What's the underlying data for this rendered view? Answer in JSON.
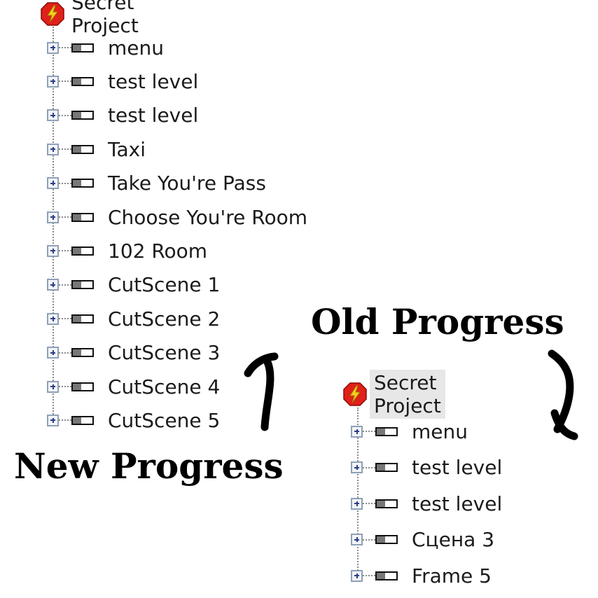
{
  "new_tree": {
    "root_label": "Secret Project",
    "items": [
      {
        "label": "menu"
      },
      {
        "label": "test level"
      },
      {
        "label": "test level"
      },
      {
        "label": "Taxi"
      },
      {
        "label": "Take You're Pass"
      },
      {
        "label": "Choose You're Room"
      },
      {
        "label": "102 Room"
      },
      {
        "label": "CutScene 1"
      },
      {
        "label": "CutScene 2"
      },
      {
        "label": "CutScene 3"
      },
      {
        "label": "CutScene 4"
      },
      {
        "label": "CutScene 5"
      }
    ]
  },
  "old_tree": {
    "root_label": "Secret Project",
    "items": [
      {
        "label": "menu"
      },
      {
        "label": "test level"
      },
      {
        "label": "test level"
      },
      {
        "label": "Сцена 3"
      },
      {
        "label": "Frame 5"
      }
    ]
  },
  "captions": {
    "new_progress": "New Progress",
    "old_progress": "Old Progress"
  },
  "icons": {
    "root": "flash-project-icon",
    "item": "frame-icon",
    "expander": "expand-plus-icon"
  },
  "colors": {
    "root_icon_red": "#e0201a",
    "root_icon_bolt": "#f5d020",
    "selection_bg": "#e7e7e7",
    "expander_border": "#8fa0b8",
    "expander_plus": "#2a3f86"
  }
}
